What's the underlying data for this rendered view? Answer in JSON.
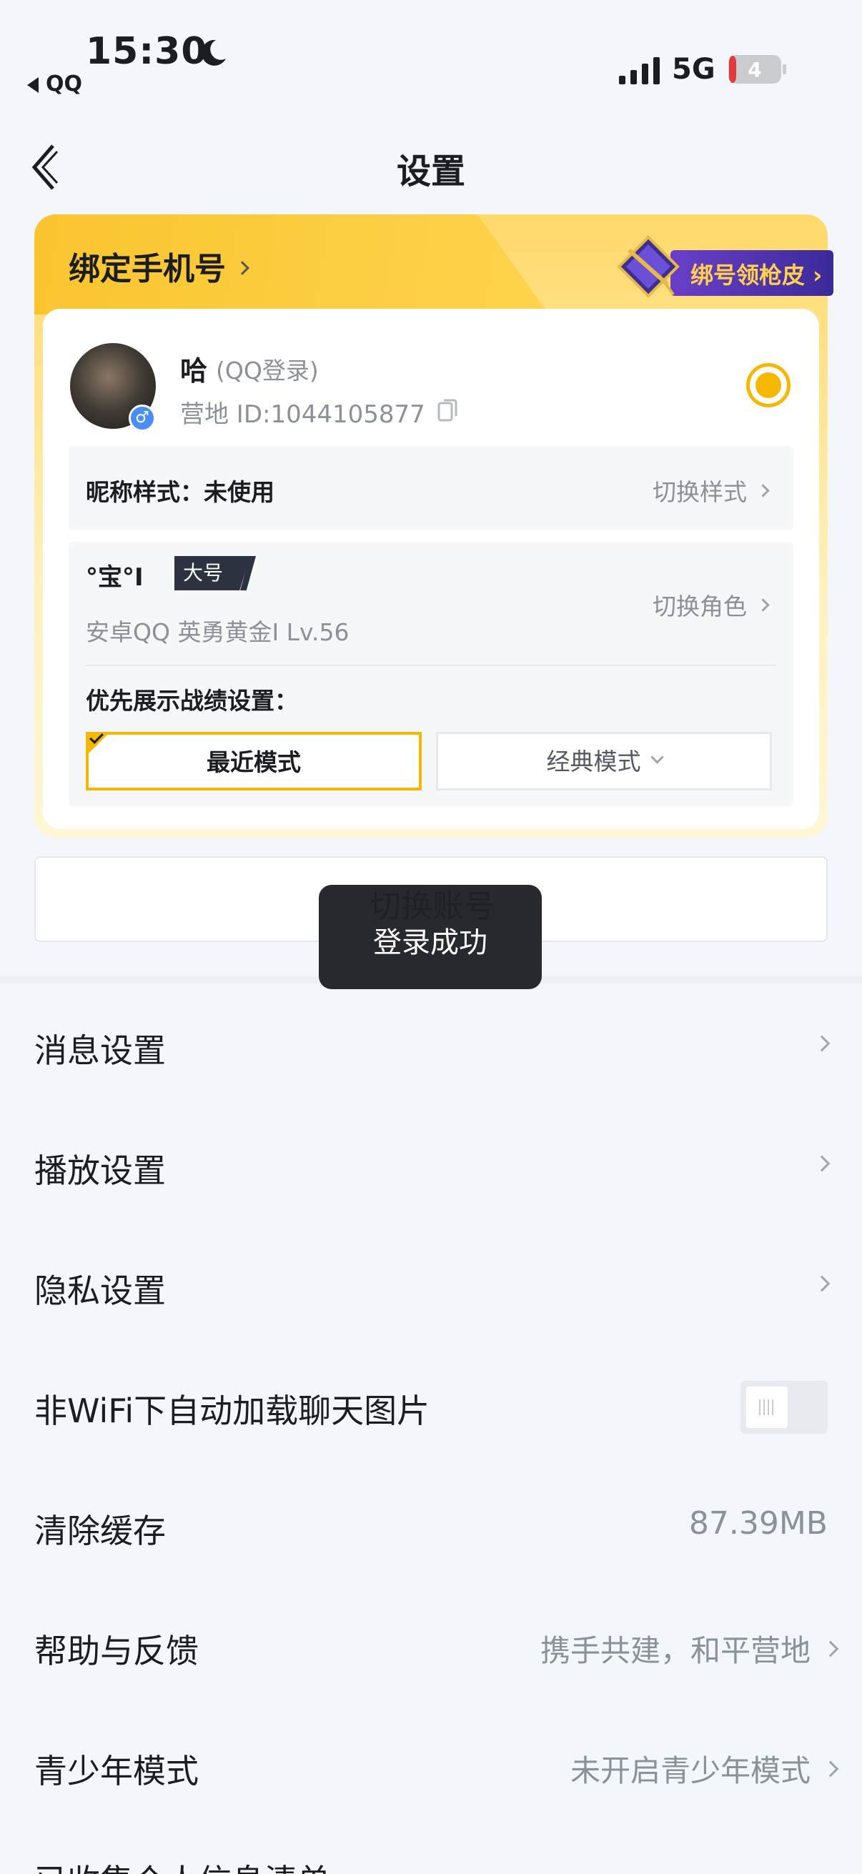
{
  "status_bar": {
    "time": "15:30",
    "back_app": "QQ",
    "network": "5G",
    "battery": "4"
  },
  "nav": {
    "title": "设置"
  },
  "profile_card": {
    "bind_phone": "绑定手机号",
    "promo": "绑号领枪皮",
    "name": "哈",
    "login_type": "(QQ登录)",
    "ying_id": "营地 ID:1044105877",
    "nickname_style_label": "昵称样式：未使用",
    "nickname_style_action": "切换样式",
    "role_name": "°宝°I",
    "role_tag": "大号",
    "role_info": "安卓QQ  英勇黄金I  Lv.56",
    "role_switch": "切换角色",
    "priority_label": "优先展示战绩设置：",
    "mode_recent": "最近模式",
    "mode_classic": "经典模式"
  },
  "switch_account": "切换账号",
  "toast": "登录成功",
  "settings": {
    "message": "消息设置",
    "playback": "播放设置",
    "privacy": "隐私设置",
    "auto_load": "非WiFi下自动加载聊天图片",
    "auto_load_enabled": false,
    "clear_cache": "清除缓存",
    "cache_size": "87.39MB",
    "help": "帮助与反馈",
    "help_value": "携手共建，和平营地",
    "teen": "青少年模式",
    "teen_value": "未开启青少年模式",
    "partial_next": "已收集个人信息清单"
  },
  "colors": {
    "accent": "#f6b700",
    "background": "#f3f6fa"
  }
}
